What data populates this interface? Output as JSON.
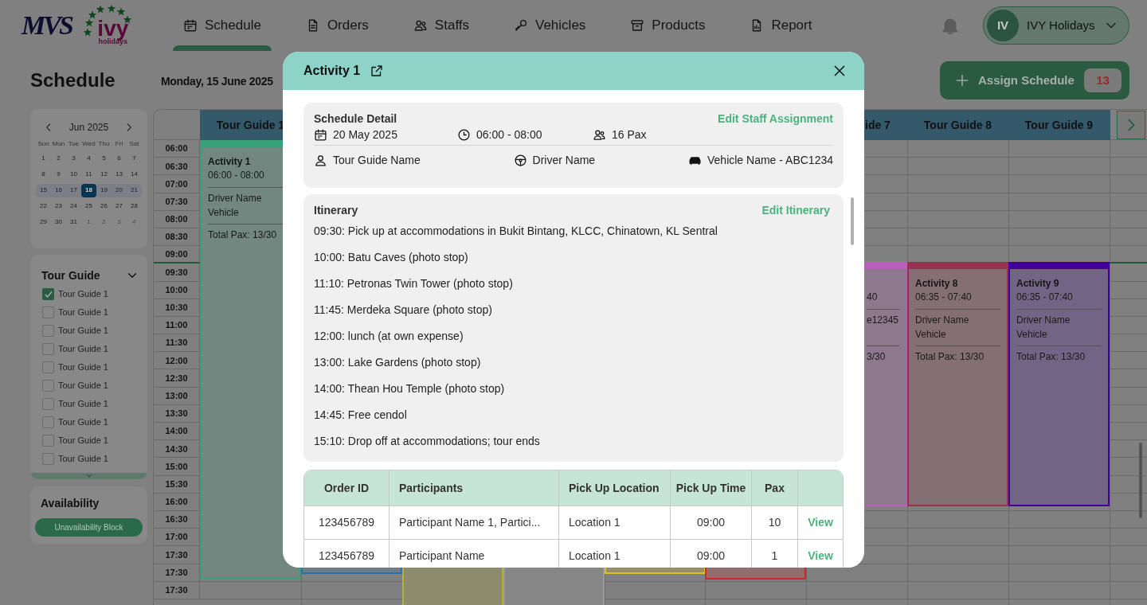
{
  "nav": {
    "logos": [
      {
        "text": "MVS"
      },
      {
        "text": "ivy",
        "subtext": "holidays"
      }
    ],
    "items": [
      {
        "label": "Schedule",
        "selected": true
      },
      {
        "label": "Orders",
        "selected": false
      },
      {
        "label": "Staffs",
        "selected": false
      },
      {
        "label": "Vehicles",
        "selected": false
      },
      {
        "label": "Products",
        "selected": false
      },
      {
        "label": "Report",
        "selected": false
      }
    ],
    "user": {
      "initials": "IV",
      "name": "IVY Holidays"
    }
  },
  "page": {
    "title": "Schedule",
    "date": "Monday, 15 June 2025",
    "assign_button": {
      "label": "Assign Schedule",
      "count": "13"
    }
  },
  "calendar": {
    "month": "Jun 2025",
    "weekdays": [
      "Sun",
      "Mon",
      "Tue",
      "Wed",
      "Thu",
      "Fri",
      "Sat"
    ],
    "weeks": [
      {
        "highlighted": false,
        "days": [
          {
            "label": "1",
            "selected": false,
            "outside": false
          },
          {
            "label": "2",
            "selected": false,
            "outside": false
          },
          {
            "label": "3",
            "selected": false,
            "outside": false
          },
          {
            "label": "4",
            "selected": false,
            "outside": false
          },
          {
            "label": "5",
            "selected": false,
            "outside": false
          },
          {
            "label": "6",
            "selected": false,
            "outside": false
          },
          {
            "label": "7",
            "selected": false,
            "outside": false
          }
        ]
      },
      {
        "highlighted": false,
        "days": [
          {
            "label": "8",
            "selected": false,
            "outside": false
          },
          {
            "label": "9",
            "selected": false,
            "outside": false
          },
          {
            "label": "10",
            "selected": false,
            "outside": false
          },
          {
            "label": "11",
            "selected": false,
            "outside": false
          },
          {
            "label": "12",
            "selected": false,
            "outside": false
          },
          {
            "label": "13",
            "selected": false,
            "outside": false
          },
          {
            "label": "14",
            "selected": false,
            "outside": false
          }
        ]
      },
      {
        "highlighted": true,
        "days": [
          {
            "label": "15",
            "selected": false,
            "outside": false
          },
          {
            "label": "16",
            "selected": false,
            "outside": false
          },
          {
            "label": "17",
            "selected": false,
            "outside": false
          },
          {
            "label": "18",
            "selected": true,
            "outside": false
          },
          {
            "label": "19",
            "selected": false,
            "outside": false
          },
          {
            "label": "20",
            "selected": false,
            "outside": false
          },
          {
            "label": "21",
            "selected": false,
            "outside": false
          }
        ]
      },
      {
        "highlighted": false,
        "days": [
          {
            "label": "22",
            "selected": false,
            "outside": false
          },
          {
            "label": "23",
            "selected": false,
            "outside": false
          },
          {
            "label": "24",
            "selected": false,
            "outside": false
          },
          {
            "label": "25",
            "selected": false,
            "outside": false
          },
          {
            "label": "26",
            "selected": false,
            "outside": false
          },
          {
            "label": "27",
            "selected": false,
            "outside": false
          },
          {
            "label": "28",
            "selected": false,
            "outside": false
          }
        ]
      },
      {
        "highlighted": false,
        "days": [
          {
            "label": "29",
            "selected": false,
            "outside": false
          },
          {
            "label": "30",
            "selected": false,
            "outside": false
          },
          {
            "label": "31",
            "selected": false,
            "outside": false
          },
          {
            "label": "1",
            "selected": false,
            "outside": true
          },
          {
            "label": "2",
            "selected": false,
            "outside": true
          },
          {
            "label": "3",
            "selected": false,
            "outside": true
          },
          {
            "label": "4",
            "selected": false,
            "outside": true
          }
        ]
      }
    ]
  },
  "tour_guide_filter": {
    "title": "Tour Guide",
    "items": [
      {
        "label": "Tour Guide 1",
        "checked": true
      },
      {
        "label": "Tour Guide 1",
        "checked": false
      },
      {
        "label": "Tour Guide 1",
        "checked": false
      },
      {
        "label": "Tour Guide 1",
        "checked": false
      },
      {
        "label": "Tour Guide 1",
        "checked": false
      },
      {
        "label": "Tour Guide 1",
        "checked": false
      },
      {
        "label": "Tour Guide 1",
        "checked": false
      },
      {
        "label": "Tour Guide 1",
        "checked": false
      },
      {
        "label": "Tour Guide 1",
        "checked": false
      },
      {
        "label": "Tour Guide 1",
        "checked": false
      }
    ]
  },
  "availability": {
    "title": "Availability",
    "button": "Unavailability Block"
  },
  "schedule_grid": {
    "columns": [
      {
        "label": "Tour Guide 1"
      },
      {
        "label": "ide 7"
      },
      {
        "label": "Tour Guide 8"
      },
      {
        "label": "Tour Guide 9"
      }
    ],
    "times": [
      "06:00",
      "06:30",
      "07:00",
      "07:30",
      "08:00",
      "08:30",
      "09:00",
      "09:30",
      "10:00",
      "10:30",
      "11:00",
      "11:30",
      "12:00",
      "12:30",
      "13:00",
      "13:30",
      "14:00",
      "14:30",
      "15:00",
      "15:30",
      "16:00",
      "16:30",
      "17:00",
      "17:30",
      "17:30",
      "17:30"
    ],
    "activities": [
      {
        "title": "Activity 1",
        "time": "06:00 - 08:00",
        "driver": "Driver Name",
        "vehicle": "Vehicle",
        "pax": "Total Pax: 13/30",
        "color": "#3aa07c"
      },
      {
        "time": "40",
        "driver": "e12345",
        "pax": "3/30",
        "color": "#bc5cbc"
      },
      {
        "title": "Activity 8",
        "time": "06:35 - 07:40",
        "driver": "Driver Name",
        "vehicle": "Vehicle",
        "pax": "Total Pax: 13/30",
        "color": "#943450"
      },
      {
        "title": "Activity 9",
        "time": "06:35 - 07:40",
        "driver": "Driver Name",
        "vehicle": "Vehicle",
        "pax": "Total Pax: 13/30",
        "color": "#420094"
      },
      {
        "color": "#2f6fa8"
      },
      {
        "color": "#b8b030"
      },
      {
        "color": "#9a9a9a"
      },
      {
        "color": "#e0c020"
      },
      {
        "color": "#d02828"
      }
    ]
  },
  "modal": {
    "title": "Activity 1",
    "schedule_detail": {
      "title": "Schedule Detail",
      "edit_link": "Edit Staff Assignment",
      "date": "20 May 2025",
      "time": "06:00 - 08:00",
      "pax": "16 Pax",
      "tour_guide": "Tour Guide Name",
      "driver": "Driver Name",
      "vehicle": "Vehicle Name - ABC1234"
    },
    "itinerary": {
      "title": "Itinerary",
      "edit_link": "Edit Itinerary",
      "items": [
        "09:30: Pick up at accommodations in Bukit Bintang, KLCC, Chinatown, KL Sentral",
        "10:00: Batu Caves (photo stop)",
        "11:10: Petronas Twin Tower (photo stop)",
        "11:45: Merdeka Square (photo stop)",
        "12:00: lunch (at own expense)",
        "13:00: Lake Gardens (photo stop)",
        "14:00: Thean Hou Temple (photo stop)",
        "14:45: Free cendol",
        "15:10: Drop off at accommodations; tour ends"
      ]
    },
    "orders": {
      "columns": [
        "Order ID",
        "Participants",
        "Pick Up Location",
        "Pick Up Time",
        "Pax"
      ],
      "rows": [
        {
          "order_id": "123456789",
          "participants": "Participant Name 1, Partici...",
          "location": "Location 1",
          "time": "09:00",
          "pax": "10",
          "action": "View"
        },
        {
          "order_id": "123456789",
          "participants": "Participant Name",
          "location": "Location 1",
          "time": "09:00",
          "pax": "1",
          "action": "View"
        }
      ]
    }
  }
}
